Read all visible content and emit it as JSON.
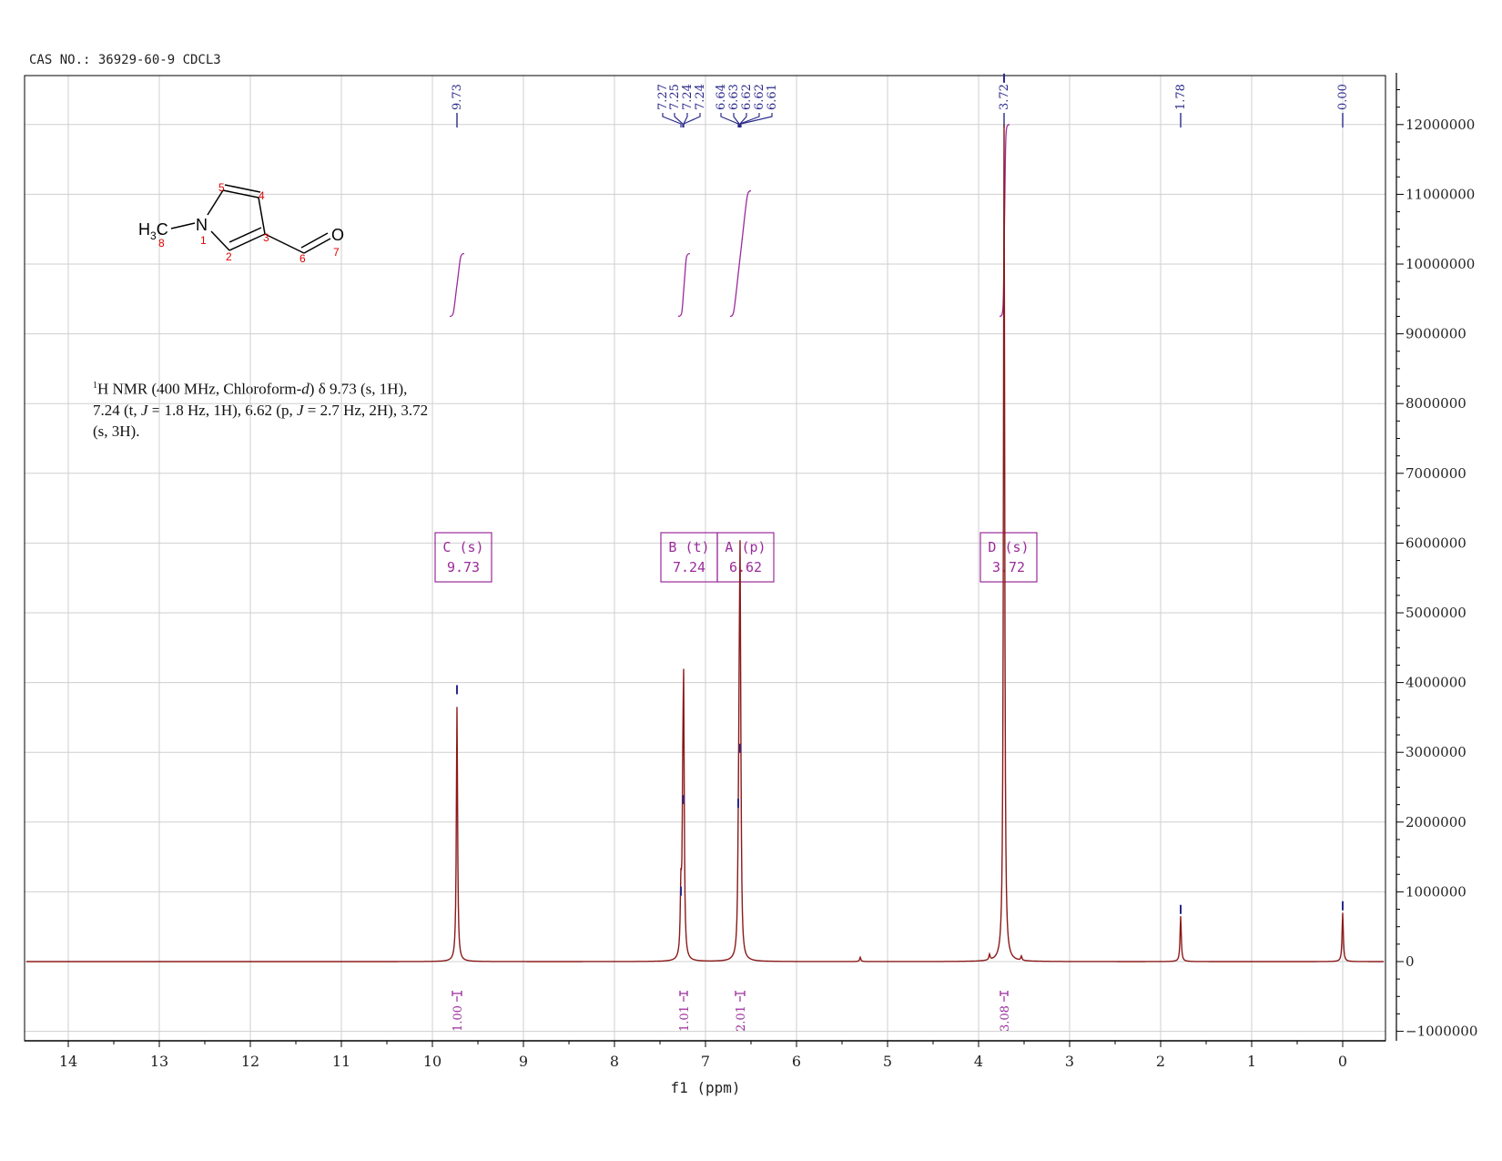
{
  "header": {
    "cas_label": "CAS NO.: 36929-60-9 CDCL3"
  },
  "caption": {
    "sup": "1",
    "line1": "H NMR (400 MHz, Chloroform-",
    "solvent_italic": "d",
    "line1b": ") δ 9.73 (s, 1H),",
    "line2a": "7.24 (t, ",
    "J": "J",
    "line2b": " = 1.8 Hz, 1H), 6.62 (p, ",
    "line2c": " = 2.7 Hz, 2H), 3.72",
    "line3": "(s, 3H)."
  },
  "structure": {
    "atoms": [
      "H3C",
      "N",
      "O"
    ],
    "numbers": [
      "1",
      "2",
      "3",
      "4",
      "5",
      "6",
      "7",
      "8"
    ]
  },
  "chart_data": {
    "type": "line",
    "xlabel": "f1 (ppm)",
    "x_ticks": [
      "14",
      "13",
      "12",
      "11",
      "10",
      "9",
      "8",
      "7",
      "6",
      "5",
      "4",
      "3",
      "2",
      "1",
      "0"
    ],
    "y_ticks": [
      "12000000",
      "11000000",
      "10000000",
      "9000000",
      "8000000",
      "7000000",
      "6000000",
      "5000000",
      "4000000",
      "3000000",
      "2000000",
      "1000000",
      "0",
      "−1000000"
    ],
    "xlim": [
      14.5,
      -0.5
    ],
    "ylim": [
      -1200000,
      12700000
    ],
    "reversed_x": true,
    "grid": true,
    "colors": {
      "spectrum": "#8b1a1a",
      "peak_label": "#2a2a8c",
      "integral": "#9b2b9b",
      "atom_number": "#e00000"
    },
    "peaks": [
      {
        "ppm": 9.73,
        "height": 3650000
      },
      {
        "ppm": 7.27,
        "height": 900000
      },
      {
        "ppm": 7.25,
        "height": 1500000
      },
      {
        "ppm": 7.24,
        "height": 2150000
      },
      {
        "ppm": 7.24,
        "height": 1400000
      },
      {
        "ppm": 6.64,
        "height": 700000
      },
      {
        "ppm": 6.63,
        "height": 2100000
      },
      {
        "ppm": 6.62,
        "height": 2850000
      },
      {
        "ppm": 6.62,
        "height": 2000000
      },
      {
        "ppm": 6.61,
        "height": 700000
      },
      {
        "ppm": 3.72,
        "height": 12000000
      },
      {
        "ppm": 1.78,
        "height": 650000
      },
      {
        "ppm": 0.0,
        "height": 700000
      },
      {
        "ppm": 5.3,
        "height": 60000
      },
      {
        "ppm": 3.88,
        "height": 80000
      },
      {
        "ppm": 3.53,
        "height": 60000
      }
    ],
    "peak_labels": [
      {
        "text": "9.73",
        "ppm": 9.73
      },
      {
        "text": "7.27",
        "ppm": 7.27
      },
      {
        "text": "7.25",
        "ppm": 7.25
      },
      {
        "text": "7.24",
        "ppm": 7.24
      },
      {
        "text": "7.24",
        "ppm": 7.24
      },
      {
        "text": "6.64",
        "ppm": 6.64
      },
      {
        "text": "6.63",
        "ppm": 6.63
      },
      {
        "text": "6.62",
        "ppm": 6.62
      },
      {
        "text": "6.62",
        "ppm": 6.62
      },
      {
        "text": "6.61",
        "ppm": 6.61
      },
      {
        "text": "3.72",
        "ppm": 3.72
      },
      {
        "text": "1.78",
        "ppm": 1.78
      },
      {
        "text": "0.00",
        "ppm": 0.0
      }
    ],
    "integrals": [
      {
        "value": "1.00",
        "ppm": 9.73,
        "from": 9.78,
        "to": 9.68
      },
      {
        "value": "1.01",
        "ppm": 7.24,
        "from": 7.28,
        "to": 7.2
      },
      {
        "value": "2.01",
        "ppm": 6.62,
        "from": 6.67,
        "to": 6.57
      },
      {
        "value": "3.08",
        "ppm": 3.72,
        "from": 3.76,
        "to": 3.68
      }
    ],
    "integral_curves": [
      {
        "ppm_from": 9.78,
        "ppm_to": 9.68,
        "y_start": 9250000,
        "y_end": 10150000
      },
      {
        "ppm_from": 7.27,
        "ppm_to": 7.2,
        "y_start": 9250000,
        "y_end": 10150000
      },
      {
        "ppm_from": 6.7,
        "ppm_to": 6.53,
        "y_start": 9250000,
        "y_end": 11050000
      },
      {
        "ppm_from": 3.74,
        "ppm_to": 3.69,
        "y_start": 9250000,
        "y_end": 12000000
      }
    ],
    "multiplets": [
      {
        "name": "C (s)",
        "shift": "9.73",
        "ppm": 9.73
      },
      {
        "name": "B (t)",
        "shift": "7.24",
        "ppm": 7.24
      },
      {
        "name": "A (p)",
        "shift": "6.62",
        "ppm": 6.62
      },
      {
        "name": "D (s)",
        "shift": "3.72",
        "ppm": 3.72
      }
    ]
  }
}
